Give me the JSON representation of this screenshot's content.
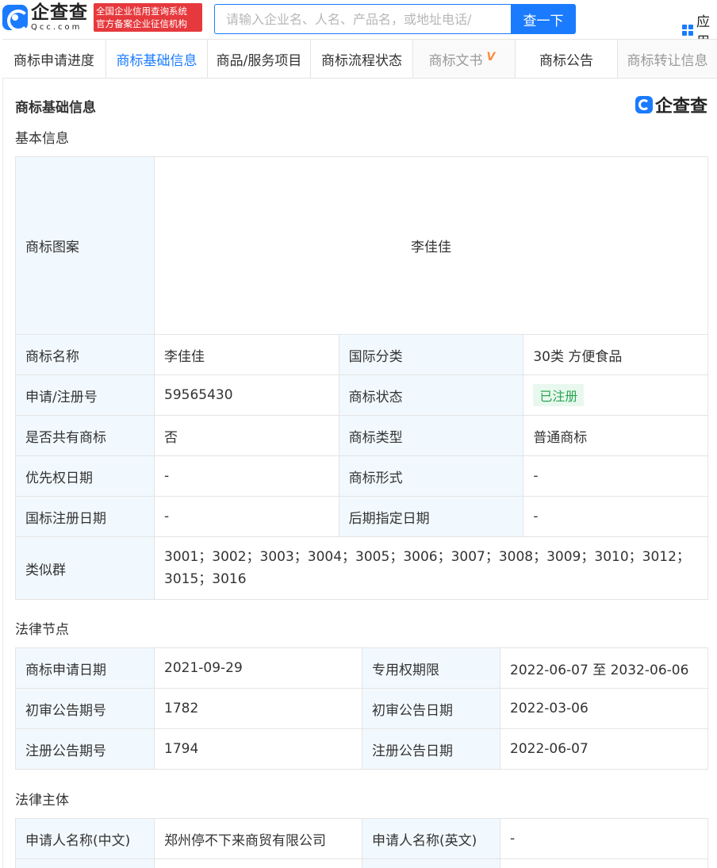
{
  "header": {
    "logo_cn": "企查查",
    "logo_en": "Qcc.com",
    "badge_line1": "全国企业信用查询系统",
    "badge_line2": "官方备案企业征信机构",
    "search_placeholder": "请输入企业名、人名、产品名，或地址电话/",
    "search_button": "查一下",
    "apps_label": "应用"
  },
  "tabs": [
    {
      "label": "商标申请进度"
    },
    {
      "label": "商标基础信息"
    },
    {
      "label": "商品/服务项目"
    },
    {
      "label": "商标流程状态"
    },
    {
      "label": "商标文书"
    },
    {
      "label": "商标公告"
    },
    {
      "label": "商标转让信息"
    }
  ],
  "main": {
    "section_title": "商标基础信息",
    "brand_logo_text": "企查查",
    "basic": {
      "title": "基本信息",
      "pattern_label": "商标图案",
      "pattern_text": "李佳佳",
      "rows": [
        {
          "l1": "商标名称",
          "v1": "李佳佳",
          "l2": "国际分类",
          "v2": "30类 方便食品"
        },
        {
          "l1": "申请/注册号",
          "v1": "59565430",
          "l2": "商标状态",
          "v2": "已注册"
        },
        {
          "l1": "是否共有商标",
          "v1": "否",
          "l2": "商标类型",
          "v2": "普通商标"
        },
        {
          "l1": "优先权日期",
          "v1": "-",
          "l2": "商标形式",
          "v2": "-"
        },
        {
          "l1": "国标注册日期",
          "v1": "-",
          "l2": "后期指定日期",
          "v2": "-"
        }
      ],
      "similar_label": "类似群",
      "similar_value": "3001；3002；3003；3004；3005；3006；3007；3008；3009；3010；3012；3015；3016"
    },
    "legal": {
      "title": "法律节点",
      "rows": [
        {
          "l1": "商标申请日期",
          "v1": "2021-09-29",
          "l2": "专用权期限",
          "v2": "2022-06-07 至 2032-06-06"
        },
        {
          "l1": "初审公告期号",
          "v1": "1782",
          "l2": "初审公告日期",
          "v2": "2022-03-06"
        },
        {
          "l1": "注册公告期号",
          "v1": "1794",
          "l2": "注册公告日期",
          "v2": "2022-06-07"
        }
      ]
    },
    "subject": {
      "title": "法律主体",
      "rows": [
        {
          "l1": "申请人名称(中文)",
          "v1": "郑州停不下来商贸有限公司",
          "l2": "申请人名称(英文)",
          "v2": "-"
        }
      ]
    }
  },
  "colors": {
    "accent": "#1a7bff",
    "badge_red": "#e6393d",
    "label_bg": "#f2f9fe",
    "status_green": "#2aa552"
  }
}
